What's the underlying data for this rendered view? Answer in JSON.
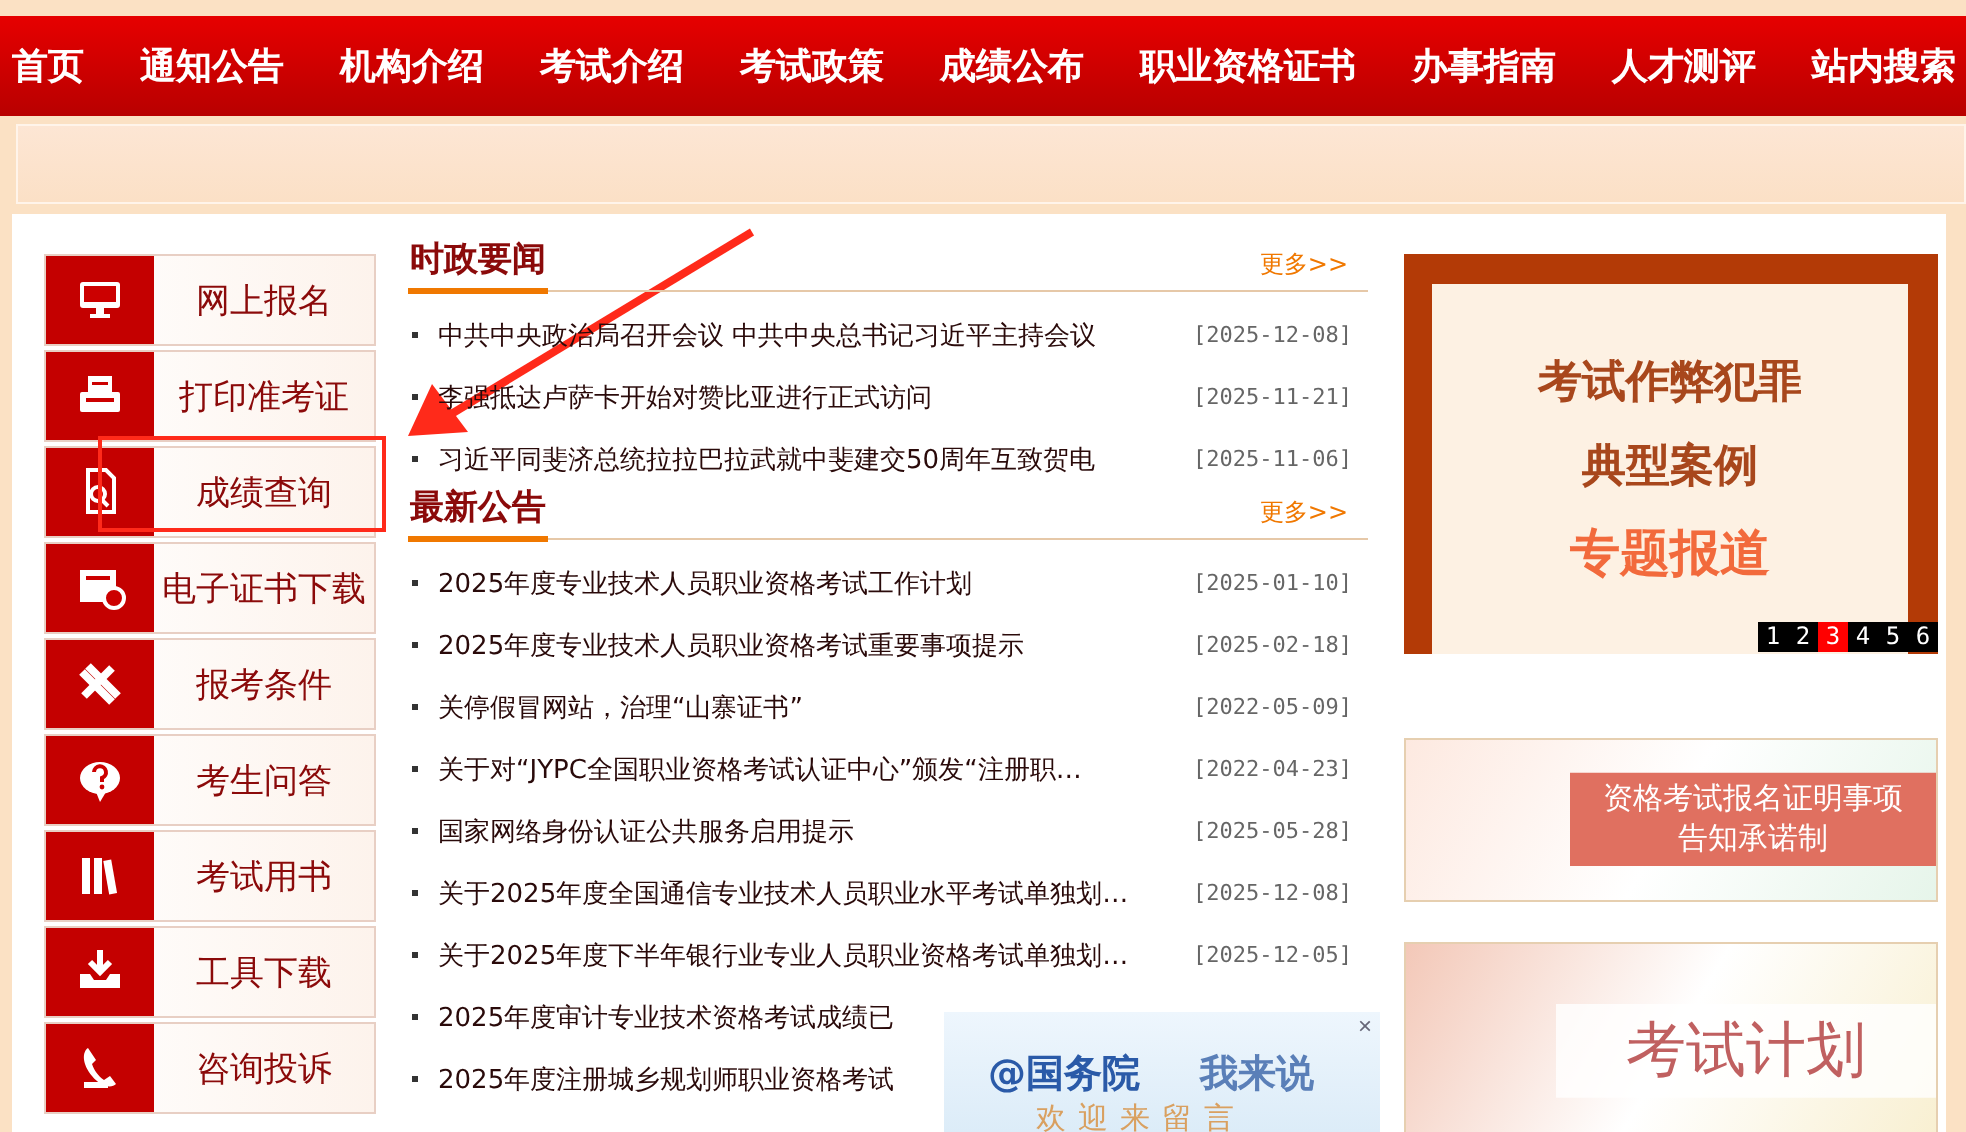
{
  "nav": {
    "items": [
      "首页",
      "通知公告",
      "机构介绍",
      "考试介绍",
      "考试政策",
      "成绩公布",
      "职业资格证书",
      "办事指南",
      "人才测评",
      "站内搜索"
    ]
  },
  "sidebar": {
    "items": [
      {
        "label": "网上报名",
        "highlighted": false
      },
      {
        "label": "打印准考证",
        "highlighted": false
      },
      {
        "label": "成绩查询",
        "highlighted": true
      },
      {
        "label": "电子证书下载",
        "highlighted": false
      },
      {
        "label": "报考条件",
        "highlighted": false
      },
      {
        "label": "考生问答",
        "highlighted": false
      },
      {
        "label": "考试用书",
        "highlighted": false
      },
      {
        "label": "工具下载",
        "highlighted": false
      },
      {
        "label": "咨询投诉",
        "highlighted": false
      }
    ]
  },
  "sections": [
    {
      "title": "时政要闻",
      "more": "更多>>",
      "items": [
        {
          "title": "中共中央政治局召开会议 中共中央总书记习近平主持会议",
          "date": "[2025-12-08]"
        },
        {
          "title": "李强抵达卢萨卡开始对赞比亚进行正式访问",
          "date": "[2025-11-21]"
        },
        {
          "title": "习近平同斐济总统拉拉巴拉武就中斐建交50周年互致贺电",
          "date": "[2025-11-06]"
        }
      ]
    },
    {
      "title": "最新公告",
      "more": "更多>>",
      "items": [
        {
          "title": "2025年度专业技术人员职业资格考试工作计划",
          "date": "[2025-01-10]"
        },
        {
          "title": "2025年度专业技术人员职业资格考试重要事项提示",
          "date": "[2025-02-18]"
        },
        {
          "title": "关停假冒网站，治理“山寨证书”",
          "date": "[2022-05-09]"
        },
        {
          "title": "关于对“JYPC全国职业资格考试认证中心”颁发“注册职…",
          "date": "[2022-04-23]"
        },
        {
          "title": "国家网络身份认证公共服务启用提示",
          "date": "[2025-05-28]"
        },
        {
          "title": "关于2025年度全国通信专业技术人员职业水平考试单独划…",
          "date": "[2025-12-08]"
        },
        {
          "title": "关于2025年度下半年银行业专业人员职业资格考试单独划…",
          "date": "[2025-12-05]"
        },
        {
          "title": "2025年度审计专业技术资格考试成绩已"
        },
        {
          "title": "2025年度注册城乡规划师职业资格考试"
        }
      ]
    }
  ],
  "slideshow": {
    "lines": [
      "考试作弊犯罪",
      "典型案例",
      "专题报道"
    ],
    "pages": [
      {
        "label": "1",
        "selected": false
      },
      {
        "label": "2",
        "selected": false
      },
      {
        "label": "3",
        "selected": true
      },
      {
        "label": "4",
        "selected": false
      },
      {
        "label": "5",
        "selected": false
      },
      {
        "label": "6",
        "selected": false
      }
    ]
  },
  "banners": [
    {
      "lines": [
        "资格考试报名证明事项",
        "告知承诺制"
      ]
    },
    {
      "lines": [
        "考试计划"
      ]
    }
  ],
  "popup": {
    "title": "@国务院",
    "title_suffix": "我来说",
    "subtitle": "欢迎来留言",
    "close": "×"
  }
}
